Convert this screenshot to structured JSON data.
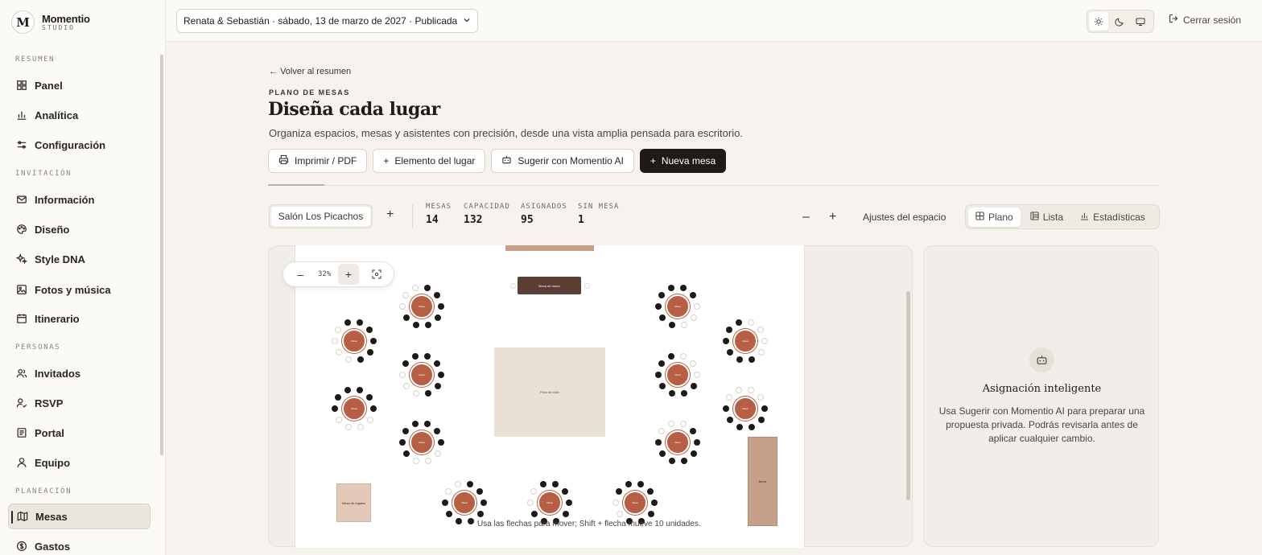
{
  "brand": {
    "name": "Momentio",
    "sub": "STUDIO",
    "logo": "M"
  },
  "sidebar": {
    "sections": [
      {
        "label": "RESUMEN",
        "items": [
          {
            "label": "Panel",
            "icon": "grid-icon"
          },
          {
            "label": "Analítica",
            "icon": "bar-chart-icon"
          },
          {
            "label": "Configuración",
            "icon": "sliders-icon"
          }
        ]
      },
      {
        "label": "INVITACIÓN",
        "items": [
          {
            "label": "Información",
            "icon": "mail-icon"
          },
          {
            "label": "Diseño",
            "icon": "palette-icon"
          },
          {
            "label": "Style DNA",
            "icon": "sparkles-icon"
          },
          {
            "label": "Fotos y música",
            "icon": "image-icon"
          },
          {
            "label": "Itinerario",
            "icon": "calendar-icon"
          }
        ]
      },
      {
        "label": "PERSONAS",
        "items": [
          {
            "label": "Invitados",
            "icon": "users-icon"
          },
          {
            "label": "RSVP",
            "icon": "user-check-icon"
          },
          {
            "label": "Portal",
            "icon": "document-icon"
          },
          {
            "label": "Equipo",
            "icon": "user-icon"
          }
        ]
      },
      {
        "label": "PLANEACIÓN",
        "items": [
          {
            "label": "Mesas",
            "icon": "map-icon",
            "active": true
          },
          {
            "label": "Gastos",
            "icon": "dollar-icon"
          }
        ]
      }
    ]
  },
  "topbar": {
    "event": "Renata & Sebastián · sábado, 13 de marzo de 2027 · Publicada",
    "logout": "Cerrar sesión"
  },
  "header": {
    "back": "Volver al resumen",
    "eyebrow": "PLANO DE MESAS",
    "title": "Diseña cada lugar",
    "description": "Organiza espacios, mesas y asistentes con precisión, desde una vista amplia pensada para escritorio."
  },
  "actions": {
    "print": "Imprimir / PDF",
    "element": "Elemento del lugar",
    "suggest": "Sugerir con Momentio AI",
    "new_table": "Nueva mesa"
  },
  "room": {
    "name": "Salón Los Picachos"
  },
  "stats": [
    {
      "label": "MESAS",
      "value": "14"
    },
    {
      "label": "CAPACIDAD",
      "value": "132"
    },
    {
      "label": "ASIGNADOS",
      "value": "95"
    },
    {
      "label": "SIN MESA",
      "value": "1"
    }
  ],
  "space_settings": "Ajustes del espacio",
  "views": {
    "plan": "Plano",
    "list": "Lista",
    "stats": "Estadísticas"
  },
  "canvas": {
    "zoom": "32%",
    "hint": "Usa las flechas para mover; Shift + flecha mueve 10 unidades.",
    "dance_floor": "Pista de baile",
    "head_table": "Mesa de honor",
    "element_small": "Mesa de regalos",
    "element_tall": "Barra",
    "table_label": "Mesa"
  },
  "assistant": {
    "title": "Asignación inteligente",
    "text": "Usa Sugerir con Momentio AI para preparar una propuesta privada. Podrás revisarla antes de aplicar cualquier cambio."
  },
  "colors": {
    "accent": "#b65f45",
    "dark": "#1d1a17",
    "head_table": "#5a3d33"
  }
}
